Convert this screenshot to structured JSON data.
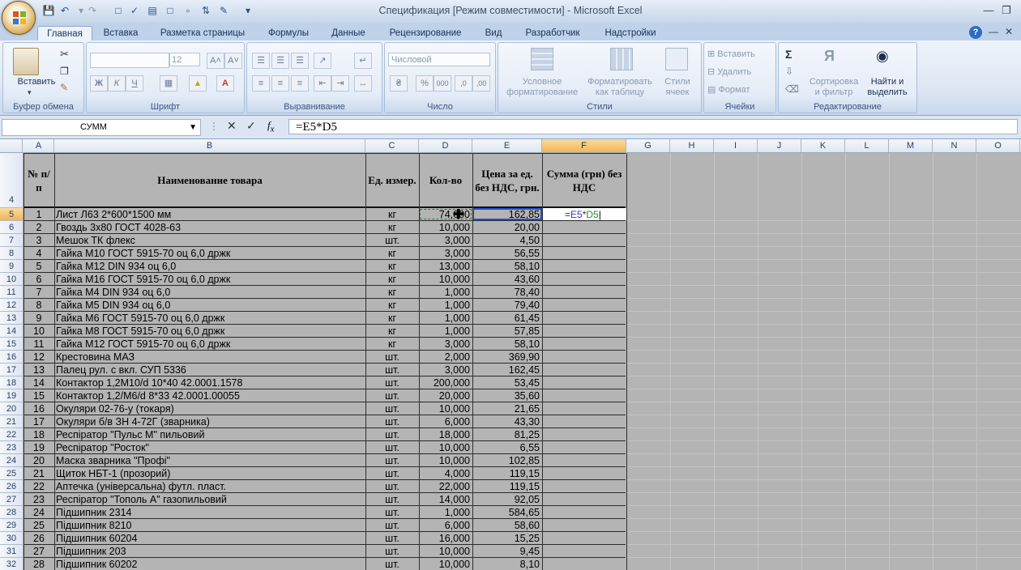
{
  "window": {
    "title": "Спецификация  [Режим совместимости] - Microsoft Excel"
  },
  "ribbon": {
    "tabs": [
      "Главная",
      "Вставка",
      "Разметка страницы",
      "Формулы",
      "Данные",
      "Рецензирование",
      "Вид",
      "Разработчик",
      "Надстройки"
    ],
    "clipboard": {
      "paste": "Вставить",
      "label": "Буфер обмена"
    },
    "font": {
      "size": "12",
      "label": "Шрифт"
    },
    "alignment": {
      "label": "Выравнивание"
    },
    "number": {
      "format": "Числовой",
      "label": "Число"
    },
    "styles": {
      "conditional": "Условное форматирование",
      "as_table": "Форматировать как таблицу",
      "cell_styles": "Стили ячеек",
      "label": "Стили"
    },
    "cells": {
      "insert": "Вставить",
      "delete": "Удалить",
      "format": "Формат",
      "label": "Ячейки"
    },
    "editing": {
      "sort": "Сортировка и фильтр",
      "find": "Найти и выделить",
      "label": "Редактирование"
    }
  },
  "formula_bar": {
    "name_box": "СУММ",
    "formula": "=E5*D5"
  },
  "columns": [
    "A",
    "B",
    "C",
    "D",
    "E",
    "F",
    "G",
    "H",
    "I",
    "J",
    "K",
    "L",
    "M",
    "N",
    "O"
  ],
  "table_header": {
    "row_number": "4",
    "a": "№ п/п",
    "b": "Наименование товара",
    "c": "Ед. измер.",
    "d": "Кол-во",
    "e": "Цена за ед. без НДС, грн.",
    "f": "Сумма (грн) без НДС"
  },
  "active_cell": {
    "col": "F",
    "row": "5",
    "edit_text": "=E5*D5"
  },
  "rows": [
    {
      "r": "5",
      "n": "1",
      "name": "Лист Л63 2*600*1500 мм",
      "unit": "кг",
      "qty": "74,000",
      "price": "162,85"
    },
    {
      "r": "6",
      "n": "2",
      "name": "Гвоздь 3х80 ГОСТ 4028-63",
      "unit": "кг",
      "qty": "10,000",
      "price": "20,00"
    },
    {
      "r": "7",
      "n": "3",
      "name": "Мешок ТК флекс",
      "unit": "шт.",
      "qty": "3,000",
      "price": "4,50"
    },
    {
      "r": "8",
      "n": "4",
      "name": "Гайка М10 ГОСТ 5915-70 оц 6,0 држк",
      "unit": "кг",
      "qty": "3,000",
      "price": "56,55"
    },
    {
      "r": "9",
      "n": "5",
      "name": "Гайка М12 DIN 934 оц 6,0",
      "unit": "кг",
      "qty": "13,000",
      "price": "58,10"
    },
    {
      "r": "10",
      "n": "6",
      "name": "Гайка М16 ГОСТ 5915-70 оц 6,0 држк",
      "unit": "кг",
      "qty": "10,000",
      "price": "43,60"
    },
    {
      "r": "11",
      "n": "7",
      "name": "Гайка М4 DIN 934 оц 6,0",
      "unit": "кг",
      "qty": "1,000",
      "price": "78,40"
    },
    {
      "r": "12",
      "n": "8",
      "name": "Гайка М5 DIN 934 оц 6,0",
      "unit": "кг",
      "qty": "1,000",
      "price": "79,40"
    },
    {
      "r": "13",
      "n": "9",
      "name": "Гайка М6 ГОСТ 5915-70 оц 6,0 држк",
      "unit": "кг",
      "qty": "1,000",
      "price": "61,45"
    },
    {
      "r": "14",
      "n": "10",
      "name": "Гайка М8 ГОСТ 5915-70 оц 6,0 држк",
      "unit": "кг",
      "qty": "1,000",
      "price": "57,85"
    },
    {
      "r": "15",
      "n": "11",
      "name": "Гайка М12 ГОСТ 5915-70 оц 6,0 држк",
      "unit": "кг",
      "qty": "3,000",
      "price": "58,10"
    },
    {
      "r": "16",
      "n": "12",
      "name": "Крестовина МАЗ",
      "unit": "шт.",
      "qty": "2,000",
      "price": "369,90"
    },
    {
      "r": "17",
      "n": "13",
      "name": "Палец рул. с вкл. СУП 5336",
      "unit": "шт.",
      "qty": "3,000",
      "price": "162,45"
    },
    {
      "r": "18",
      "n": "14",
      "name": "Контактор 1,2М10/d 10*40 42.0001.1578",
      "unit": "шт.",
      "qty": "200,000",
      "price": "53,45"
    },
    {
      "r": "19",
      "n": "15",
      "name": "Контактор 1,2/М6/d 8*33 42.0001.00055",
      "unit": "шт.",
      "qty": "20,000",
      "price": "35,60"
    },
    {
      "r": "20",
      "n": "16",
      "name": "Окуляри 02-76-у (токаря)",
      "unit": "шт.",
      "qty": "10,000",
      "price": "21,65"
    },
    {
      "r": "21",
      "n": "17",
      "name": "Окуляри б/в ЗН 4-72Г (зварника)",
      "unit": "шт.",
      "qty": "6,000",
      "price": "43,30"
    },
    {
      "r": "22",
      "n": "18",
      "name": "Респіратор \"Пульс М\" пильовий",
      "unit": "шт.",
      "qty": "18,000",
      "price": "81,25"
    },
    {
      "r": "23",
      "n": "19",
      "name": "Респіратор \"Росток\"",
      "unit": "шт.",
      "qty": "10,000",
      "price": "6,55"
    },
    {
      "r": "24",
      "n": "20",
      "name": "Маска зварника \"Профі\"",
      "unit": "шт.",
      "qty": "10,000",
      "price": "102,85"
    },
    {
      "r": "25",
      "n": "21",
      "name": "Щиток НБТ-1 (прозорий)",
      "unit": "шт.",
      "qty": "4,000",
      "price": "119,15"
    },
    {
      "r": "26",
      "n": "22",
      "name": "Аптечка (універсальна) футл. пласт.",
      "unit": "шт.",
      "qty": "22,000",
      "price": "119,15"
    },
    {
      "r": "27",
      "n": "23",
      "name": "Респіратор \"Тополь А\" газопильовий",
      "unit": "шт.",
      "qty": "14,000",
      "price": "92,05"
    },
    {
      "r": "28",
      "n": "24",
      "name": "Підшипник 2314",
      "unit": "шт.",
      "qty": "1,000",
      "price": "584,65"
    },
    {
      "r": "29",
      "n": "25",
      "name": "Підшипник 8210",
      "unit": "шт.",
      "qty": "6,000",
      "price": "58,60"
    },
    {
      "r": "30",
      "n": "26",
      "name": "Підшипник 60204",
      "unit": "шт.",
      "qty": "16,000",
      "price": "15,25"
    },
    {
      "r": "31",
      "n": "27",
      "name": "Підшипник 203",
      "unit": "шт.",
      "qty": "10,000",
      "price": "9,45"
    },
    {
      "r": "32",
      "n": "28",
      "name": "Підшипник 60202",
      "unit": "шт.",
      "qty": "10,000",
      "price": "8,10"
    }
  ]
}
